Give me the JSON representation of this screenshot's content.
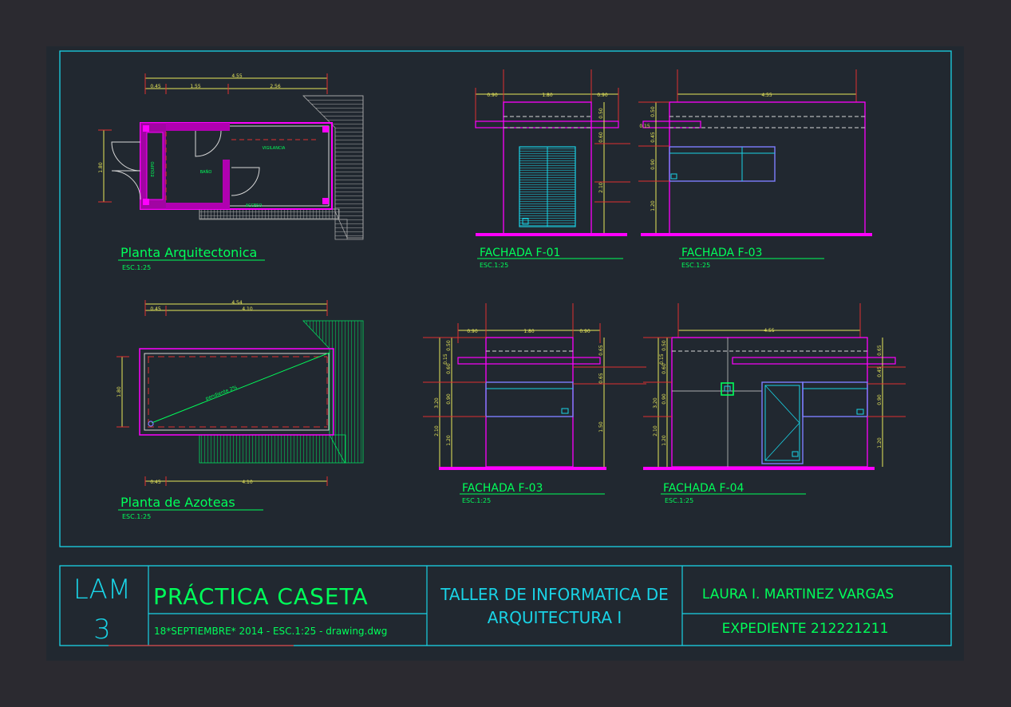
{
  "colors": {
    "background": "#2b2a30",
    "sheet": "#212830",
    "frame": "#19d3e6",
    "wall": "#ff00ff",
    "text_green": "#00ff5a",
    "dim_yellow": "#e8e85a",
    "line_white": "#d8d8d8",
    "axis_red": "#e03030",
    "hatch_grey": "#a8a8a8",
    "window_blue": "#7d7dff",
    "magenta_dark": "#b000b0"
  },
  "drawings": {
    "planta_arq": {
      "title": "Planta Arquitectonica",
      "scale": "ESC.1:25",
      "dim_total": "4.55",
      "dim_a": "0.45",
      "dim_b": "1.55",
      "dim_c": "2.56",
      "dim_height": "1.80",
      "room_equipo": "EQUIPO",
      "room_bano": "BAÑO",
      "room_vigilancia": "VIGILANCIA",
      "room_acceso": "ACCESO"
    },
    "planta_azoteas": {
      "title": "Planta de Azoteas",
      "scale": "ESC.1:25",
      "dim_total": "4.54",
      "dim_a": "0.45",
      "dim_b": "4.10",
      "dim_c": "0.45",
      "dim_d": "4.10",
      "dim_height": "1.80",
      "slope_label": "pendiente 2%"
    },
    "fachada_f01": {
      "title": "FACHADA F-01",
      "scale": "ESC.1:25",
      "dim_a": "0.90",
      "dim_b": "1.80",
      "dim_c": "0.90",
      "v1": "0.50",
      "v2": "0.60",
      "v3": "2.10"
    },
    "fachada_f03_top": {
      "title": "FACHADA F-03",
      "scale": "ESC.1:25",
      "dim_total": "4.55",
      "v0": "0.15",
      "v1": "0.50",
      "v2": "0.45",
      "v3": "0.90",
      "v4": "1.20"
    },
    "fachada_f03_bottom": {
      "title": "FACHADA F-03",
      "scale": "ESC.1:25",
      "dim_a": "0.90",
      "dim_b": "1.80",
      "dim_c": "0.90",
      "l1": "3.20",
      "l2": "2.10",
      "l3": "0.15",
      "l4": "0.50",
      "l5": "0.60",
      "l6": "0.90",
      "l7": "1.20",
      "r1": "0.65",
      "r2": "0.65",
      "r3": "1.50"
    },
    "fachada_f04": {
      "title": "FACHADA F-04",
      "scale": "ESC.1:25",
      "dim_total": "4.55",
      "l1": "3.20",
      "l2": "2.10",
      "l3": "0.15",
      "l4": "0.50",
      "l5": "0.60",
      "l6": "0.90",
      "l7": "1.20",
      "r1": "0.65",
      "r2": "0.45",
      "r3": "0.90",
      "r4": "1.20"
    }
  },
  "title_block": {
    "lam": "LAM",
    "lam_number": "3",
    "project": "PRÁCTICA CASETA",
    "date_line": "18*SEPTIEMBRE* 2014 - ESC.1:25  - drawing.dwg",
    "course_line1": "TALLER DE INFORMATICA DE",
    "course_line2": "ARQUITECTURA I",
    "author": "LAURA I. MARTINEZ VARGAS",
    "expediente": "EXPEDIENTE 212221211"
  }
}
